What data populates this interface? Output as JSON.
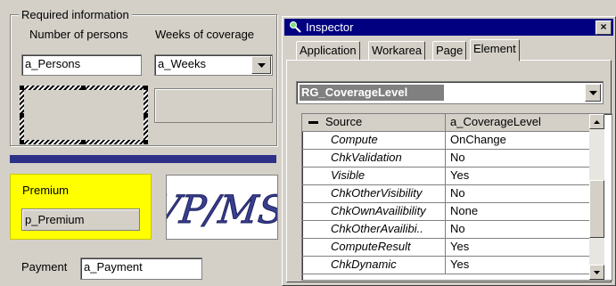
{
  "form": {
    "group_title": "Required information",
    "persons_label": "Number of persons",
    "weeks_label": "Weeks of coverage",
    "persons_value": "a_Persons",
    "weeks_value": "a_Weeks",
    "premium_label": "Premium",
    "premium_value": "p_Premium",
    "logo_text": "VP/MS",
    "payment_label": "Payment",
    "payment_value": "a_Payment",
    "colors": {
      "premium_bg": "#ffff00",
      "bar": "#2e2f86",
      "logo": "#3a3f8f"
    }
  },
  "inspector": {
    "title": "Inspector",
    "close": "×",
    "tabs": [
      "Application",
      "Workarea",
      "Page",
      "Element"
    ],
    "active_tab": "Element",
    "element_selected": "RG_CoverageLevel",
    "rows": [
      {
        "name": "Source",
        "value": "a_CoverageLevel",
        "header": true
      },
      {
        "name": "Compute",
        "value": "OnChange"
      },
      {
        "name": "ChkValidation",
        "value": "No"
      },
      {
        "name": "Visible",
        "value": "Yes"
      },
      {
        "name": "ChkOtherVisibility",
        "value": "No"
      },
      {
        "name": "ChkOwnAvailibility",
        "value": "None"
      },
      {
        "name": "ChkOtherAvailibi..",
        "value": "No"
      },
      {
        "name": "ComputeResult",
        "value": "Yes"
      },
      {
        "name": "ChkDynamic",
        "value": "Yes"
      }
    ],
    "colors": {
      "titlebar": "#000080",
      "selection": "#808080"
    }
  }
}
